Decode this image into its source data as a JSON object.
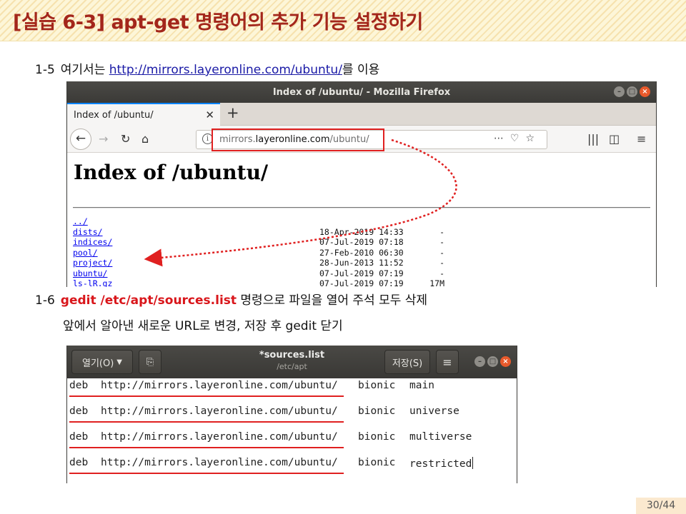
{
  "slide": {
    "title": "[실습 6-3] apt-get 명령어의 추가 기능 설정하기",
    "page_number": "30/44"
  },
  "steps": {
    "s15": {
      "num": "1-5",
      "pre": "여기서는 ",
      "link": "http://mirrors.layeronline.com/ubuntu/",
      "post": "를  이용"
    },
    "s16": {
      "num": "1-6",
      "cmd": "gedit /etc/apt/sources.list",
      "post": " 명령으로 파일을 열어 주석 모두 삭제"
    },
    "s16b": {
      "text": "앞에서 알아낸 새로운 URL로 변경, 저장 후 gedit 닫기"
    }
  },
  "firefox": {
    "window_title": "Index of /ubuntu/ - Mozilla Firefox",
    "tab_title": "Index of /ubuntu/",
    "url_prefix": "mirrors.",
    "url_host": "layeronline.com",
    "url_path": "/ubuntu/",
    "page_heading": "Index of /ubuntu/",
    "entries": [
      {
        "name": "../",
        "date": "",
        "size": ""
      },
      {
        "name": "dists/",
        "date": "18-Apr-2019 14:33",
        "size": "-"
      },
      {
        "name": "indices/",
        "date": "07-Jul-2019 07:18",
        "size": "-"
      },
      {
        "name": "pool/",
        "date": "27-Feb-2010 06:30",
        "size": "-"
      },
      {
        "name": "project/",
        "date": "28-Jun-2013 11:52",
        "size": "-"
      },
      {
        "name": "ubuntu/",
        "date": "07-Jul-2019 07:19",
        "size": "-"
      },
      {
        "name": "ls-lR.gz",
        "date": "07-Jul-2019 07:19",
        "size": "17M"
      }
    ]
  },
  "gedit": {
    "open_label": "열기(O)",
    "title": "*sources.list",
    "subtitle": "/etc/apt",
    "save_label": "저장(S)",
    "menu_icon": "hamburger-icon",
    "lines": [
      {
        "type": "deb",
        "url": "http://mirrors.layeronline.com/ubuntu/",
        "dist": "bionic",
        "component": "main"
      },
      {
        "type": "deb",
        "url": "http://mirrors.layeronline.com/ubuntu/",
        "dist": "bionic",
        "component": "universe"
      },
      {
        "type": "deb",
        "url": "http://mirrors.layeronline.com/ubuntu/",
        "dist": "bionic",
        "component": "multiverse"
      },
      {
        "type": "deb",
        "url": "http://mirrors.layeronline.com/ubuntu/",
        "dist": "bionic",
        "component": "restricted"
      }
    ]
  },
  "colors": {
    "title_text": "#a3261b",
    "highlight_red": "#e02020",
    "command_red": "#d9161b",
    "link_blue": "#1a1aa6"
  }
}
